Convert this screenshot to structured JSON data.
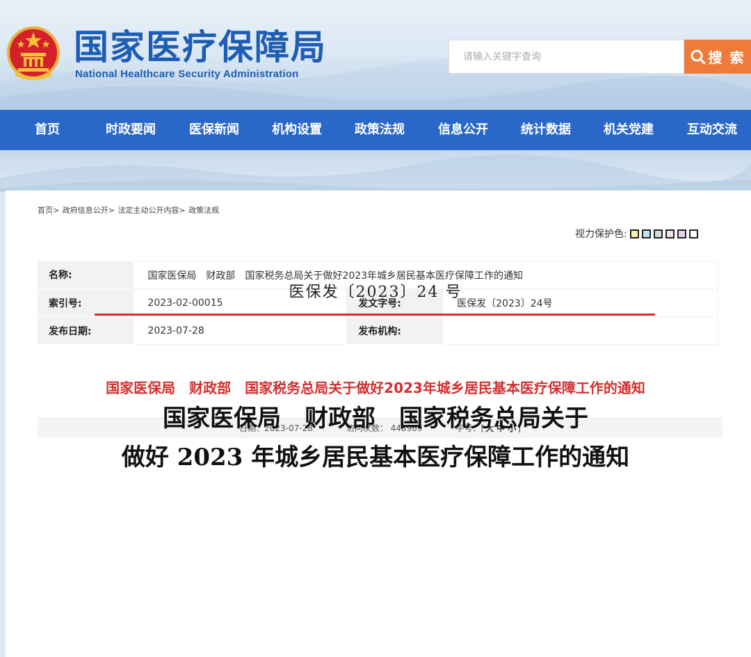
{
  "header": {
    "logo_cn": "国家医疗保障局",
    "logo_en": "National Healthcare Security Administration",
    "search_placeholder": "请输入关键字查询",
    "search_button": "搜 索"
  },
  "nav": {
    "items": [
      "首页",
      "时政要闻",
      "医保新闻",
      "机构设置",
      "政策法规",
      "信息公开",
      "统计数据",
      "机关党建",
      "互动交流"
    ]
  },
  "breadcrumb": [
    "首页>",
    "政府信息公开>",
    "法定主动公开内容>",
    "政策法规"
  ],
  "eye_protect": {
    "label": "视力保护色:",
    "colors": [
      "#f6efae",
      "#bfe3f2",
      "#d9d9d9",
      "#f0e0e8",
      "#e6d3ef",
      "#ffffff"
    ]
  },
  "meta": {
    "name_label": "名称:",
    "name_value": "国家医保局　财政部　国家税务总局关于做好2023年城乡居民基本医疗保障工作的通知",
    "index_label": "索引号:",
    "index_value": "2023-02-00015",
    "docno_label": "发文字号:",
    "docno_value": "医保发〔2023〕24号",
    "date_label": "发布日期:",
    "date_value": "2023-07-28",
    "org_label": "发布机构:",
    "org_value": ""
  },
  "doc_title": "国家医保局　财政部　国家税务总局关于做好2023年城乡居民基本医疗保障工作的通知",
  "info_bar": {
    "date": "日期：2023-07-28",
    "visits": "访问次数：  448969",
    "font_label": "字号：[",
    "font_large": "大",
    "font_medium": "中",
    "font_small": "小",
    "font_end": "]"
  },
  "doc_number": "医保发〔2023〕24 号",
  "big_title_line1": "国家医保局　财政部　国家税务总局关于",
  "big_title_line2": "做好 2023 年城乡居民基本医疗保障工作的通知",
  "colors": {
    "nav_bg": "#2968c8",
    "search_btn": "#ef7b3b",
    "title_red": "#d52e2e",
    "rule_red": "#e0282c",
    "logo_blue": "#1d5db5"
  }
}
